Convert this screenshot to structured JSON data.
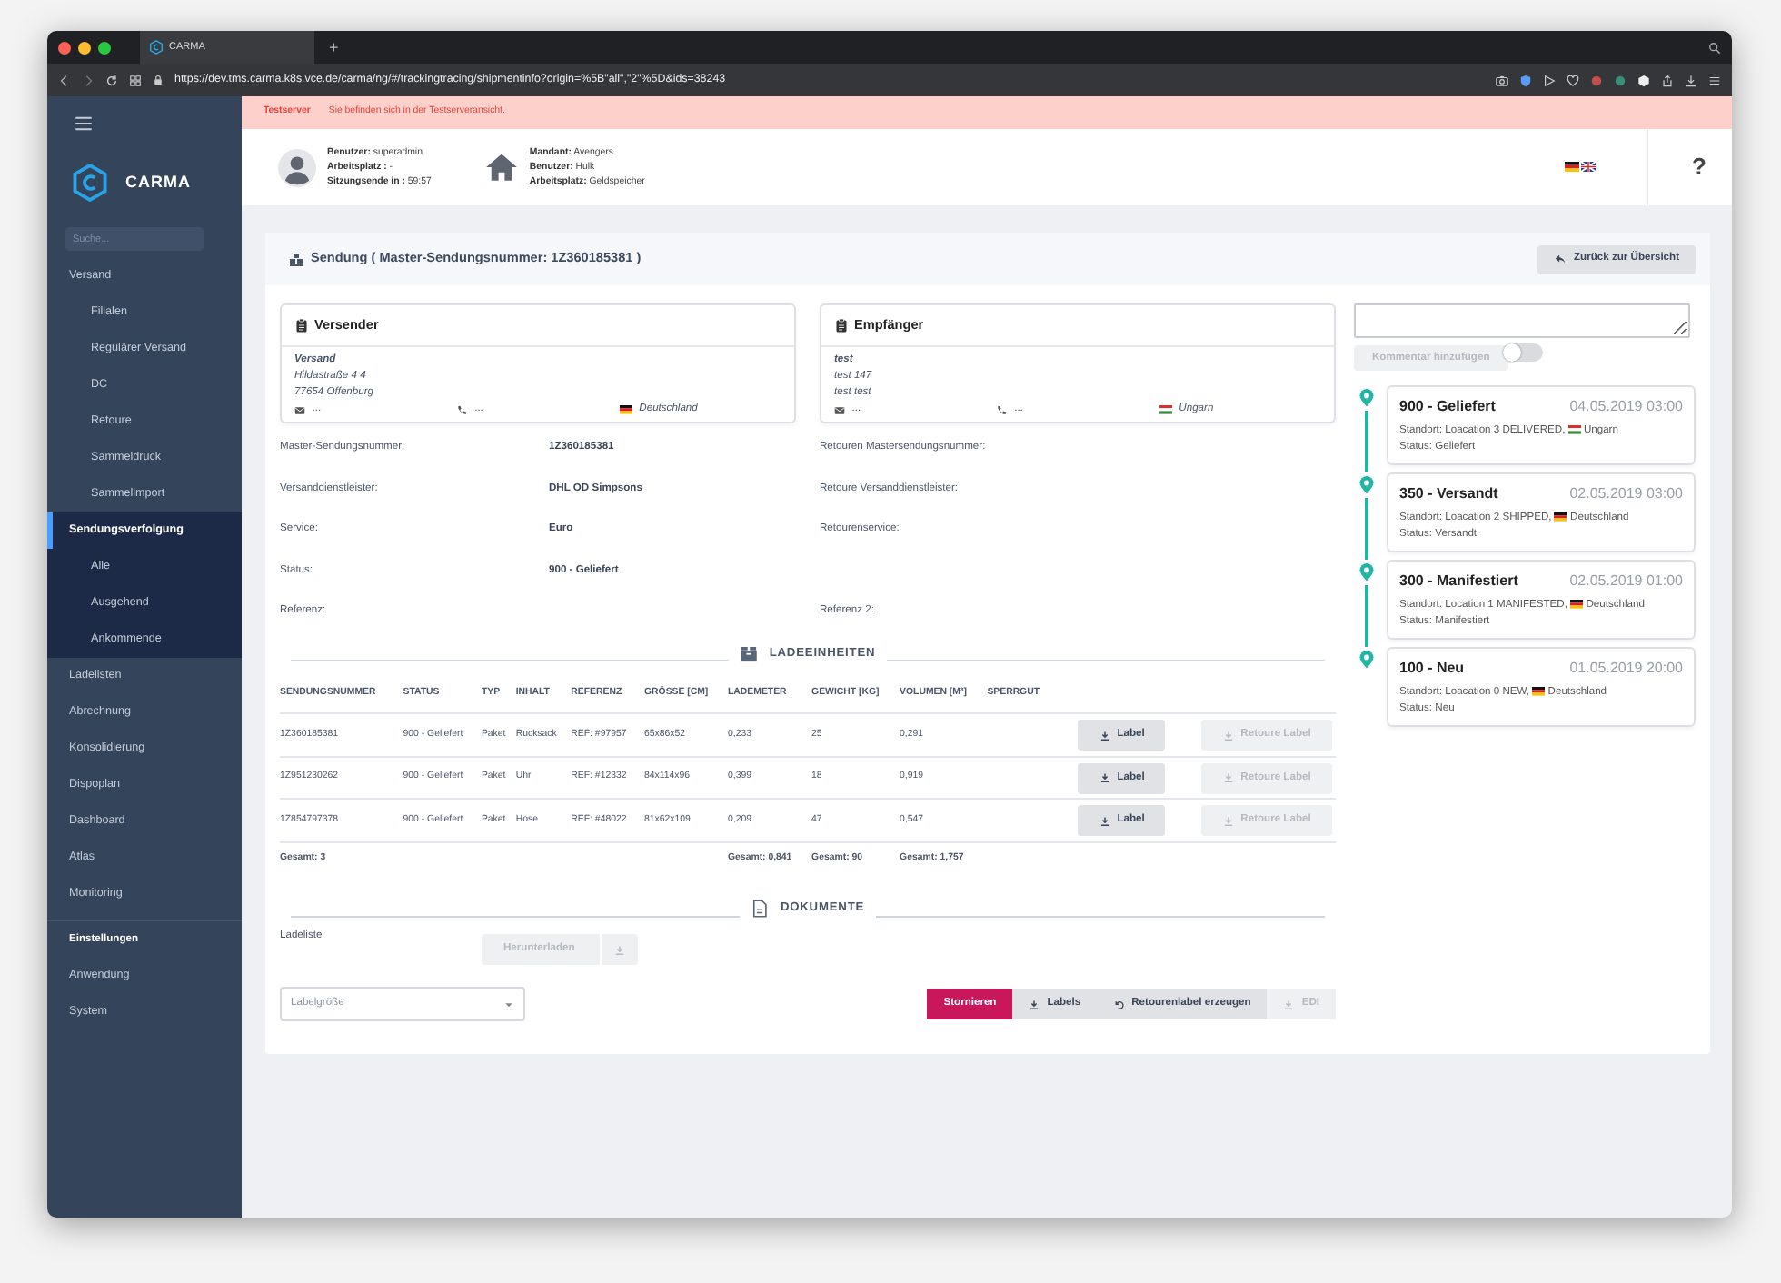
{
  "browser": {
    "tab_title": "CARMA",
    "new_tab": "+",
    "url": "https://dev.tms.carma.k8s.vce.de/carma/ng/#/trackingtracing/shipmentinfo?origin=%5B\"all\",\"2\"%5D&ids=38243"
  },
  "sidebar": {
    "brand": "CARMA",
    "search_placeholder": "Suche...",
    "items": [
      {
        "label": "Versand",
        "kind": "link",
        "selected": false,
        "expanded": true,
        "children": [
          {
            "label": "Filialen",
            "selected": false
          },
          {
            "label": "Regulärer Versand",
            "selected": false
          },
          {
            "label": "DC",
            "selected": false
          },
          {
            "label": "Retoure",
            "selected": false
          },
          {
            "label": "Sammeldruck",
            "selected": false
          },
          {
            "label": "Sammelimport",
            "selected": false
          }
        ]
      },
      {
        "label": "Sendungsverfolgung",
        "kind": "link",
        "selected": true,
        "expanded": true,
        "children": [
          {
            "label": "Alle",
            "selected": false
          },
          {
            "label": "Ausgehend",
            "selected": false
          },
          {
            "label": "Ankommende",
            "selected": false
          }
        ]
      },
      {
        "label": "Ladelisten",
        "kind": "link",
        "selected": false
      },
      {
        "label": "Abrechnung",
        "kind": "link",
        "selected": false
      },
      {
        "label": "Konsolidierung",
        "kind": "link",
        "selected": false
      },
      {
        "label": "Dispoplan",
        "kind": "link",
        "selected": false
      },
      {
        "label": "Dashboard",
        "kind": "link",
        "selected": false
      },
      {
        "label": "Atlas",
        "kind": "link",
        "selected": false
      },
      {
        "label": "Monitoring",
        "kind": "link",
        "selected": false
      },
      {
        "label": "Einstellungen",
        "kind": "heading"
      },
      {
        "label": "Anwendung",
        "kind": "link",
        "selected": false
      },
      {
        "label": "System",
        "kind": "link",
        "selected": false
      }
    ]
  },
  "banner": {
    "label": "Testserver",
    "message": "Sie befinden sich in der Testserveransicht."
  },
  "header": {
    "user": [
      "**Benutzer:** superadmin",
      "**Arbeitsplatz :** -",
      "**Sitzungsende in :** 59:57"
    ],
    "tenant": [
      "**Mandant:** Avengers",
      "**Benutzer:** Hulk",
      "**Arbeitsplatz:** Geldspeicher"
    ],
    "help": "?"
  },
  "shipment": {
    "title": "Sendung ( Master-Sendungsnummer: 1Z360185381 )",
    "back_button": "Zurück zur Übersicht",
    "parties": [
      {
        "title": "Versender",
        "name": "Versand",
        "lines": [
          "Hildastraße 4 4",
          "77654 Offenburg"
        ],
        "email": "...",
        "phone": "...",
        "kind": "de",
        "country": "Deutschland"
      },
      {
        "title": "Empfänger",
        "name": "test",
        "lines": [
          "test 147",
          "test test"
        ],
        "email": "...",
        "phone": "...",
        "kind": "hu",
        "country": "Ungarn"
      }
    ],
    "details": [
      {
        "label": "Master-Sendungsnummer:",
        "value": "1Z360185381",
        "return_label": "Retouren Mastersendungsnummer:"
      },
      {
        "label": "Versanddienstleister:",
        "value": "DHL OD Simpsons",
        "return_label": "Retoure Versanddienstleister:"
      },
      {
        "label": "Service:",
        "value": "Euro",
        "return_label": "Retourenservice:"
      },
      {
        "label": "Status:",
        "value": "900 - Geliefert"
      },
      {
        "label": "Referenz:",
        "return_label": "Referenz 2:"
      }
    ]
  },
  "loading_units": {
    "title": "LADEEINHEITEN",
    "columns": [
      "SENDUNGSNUMMER",
      "STATUS",
      "TYP",
      "INHALT",
      "REFERENZ",
      "GRÖSSE [CM]",
      "LADEMETER",
      "GEWICHT [KG]",
      "VOLUMEN [M³]",
      "SPERRGUT"
    ],
    "rows": [
      {
        "cells": [
          "1Z360185381",
          "900 - Geliefert",
          "Paket",
          "Rucksack",
          "REF: #97957",
          "65x86x52",
          "0,233",
          "25",
          "0,291"
        ],
        "label_button": {
          "text": "Label",
          "disabled": false
        },
        "return_button": {
          "text": "Retoure Label",
          "disabled": true
        }
      },
      {
        "cells": [
          "1Z951230262",
          "900 - Geliefert",
          "Paket",
          "Uhr",
          "REF: #12332",
          "84x114x96",
          "0,399",
          "18",
          "0,919"
        ],
        "label_button": {
          "text": "Label",
          "disabled": false
        },
        "return_button": {
          "text": "Retoure Label",
          "disabled": true
        }
      },
      {
        "cells": [
          "1Z854797378",
          "900 - Geliefert",
          "Paket",
          "Hose",
          "REF: #48022",
          "81x62x109",
          "0,209",
          "47",
          "0,547"
        ],
        "label_button": {
          "text": "Label",
          "disabled": false
        },
        "return_button": {
          "text": "Retoure Label",
          "disabled": true
        }
      }
    ],
    "totals": {
      "count": "Gesamt: 3",
      "loading_meters": "Gesamt: 0,841",
      "weight": "Gesamt: 90",
      "volume": "Gesamt: 1,757"
    }
  },
  "documents": {
    "title": "DOKUMENTE",
    "items": [
      {
        "label": "Ladeliste",
        "button": "Herunterladen",
        "disabled": true
      }
    ]
  },
  "footer": {
    "select_placeholder": "Labelgröße",
    "actions": [
      {
        "label": "Stornieren",
        "kind": "plain",
        "primary": true,
        "disabled": false
      },
      {
        "label": "Labels",
        "kind": "download",
        "primary": false,
        "disabled": false
      },
      {
        "label": "Retourenlabel erzeugen",
        "kind": "undo",
        "primary": false,
        "disabled": false
      },
      {
        "label": "EDI",
        "kind": "download",
        "primary": false,
        "disabled": true
      }
    ]
  },
  "comment": {
    "button": "Kommentar hinzufügen",
    "disabled": true,
    "toggle_on": false
  },
  "timeline": [
    {
      "title": "900 - Geliefert",
      "date": "04.05.2019 03:00",
      "location": "Standort: Loacation 3 DELIVERED,",
      "kind": "hu",
      "country": "Ungarn",
      "status": "Status: Geliefert"
    },
    {
      "title": "350 - Versandt",
      "date": "02.05.2019 03:00",
      "location": "Standort: Loacation 2 SHIPPED,",
      "kind": "de",
      "country": "Deutschland",
      "status": "Status: Versandt"
    },
    {
      "title": "300 - Manifestiert",
      "date": "02.05.2019 01:00",
      "location": "Standort: Location 1 MANIFESTED,",
      "kind": "de",
      "country": "Deutschland",
      "status": "Status: Manifestiert"
    },
    {
      "title": "100 - Neu",
      "date": "01.05.2019 20:00",
      "location": "Standort: Loacation 0 NEW,",
      "kind": "de",
      "country": "Deutschland",
      "status": "Status: Neu"
    }
  ]
}
